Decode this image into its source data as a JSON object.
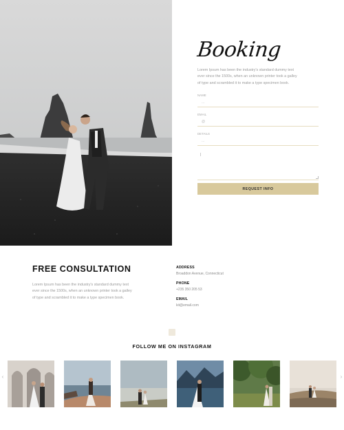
{
  "booking": {
    "title": "Booking",
    "description": "Lorem Ipsum has been the industry's standard dummy text ever since the 1500s, when an unknown printer took a galley of type and scrambled it to make a type specimen book.",
    "fields": [
      {
        "label": "NAME",
        "placeholder": "...",
        "icon": "none"
      },
      {
        "label": "EMAIL",
        "placeholder": "@",
        "icon": "at-icon"
      },
      {
        "label": "DETAILS",
        "placeholder": "...",
        "icon": "none"
      }
    ],
    "submit_label": "REQUEST INFO"
  },
  "consultation": {
    "title": "FREE CONSULTATION",
    "description": "Lorem Ipsum has been the industry's standard dummy text ever since the 1500s, when an unknown printer took a galley of type and scrambled it to make a type specimen book."
  },
  "contact": {
    "address_label": "ADDRESS",
    "address_value": "Broaddon Avenue, Connecticut",
    "phone_label": "PHONE",
    "phone_value": "+235 350 205 53",
    "email_label": "EMAIL",
    "email_value": "kit@email.com"
  },
  "instagram": {
    "title": "FOLLOW ME ON INSTAGRAM",
    "prev_arrow": "‹",
    "next_arrow": "›",
    "images": [
      "wedding-photo-1",
      "wedding-photo-2",
      "wedding-photo-3",
      "wedding-photo-4",
      "wedding-photo-5",
      "wedding-photo-6"
    ]
  },
  "colors": {
    "accent": "#d8c99c",
    "field_line": "#e6dcbf",
    "muted_text": "#9a9a9a"
  }
}
